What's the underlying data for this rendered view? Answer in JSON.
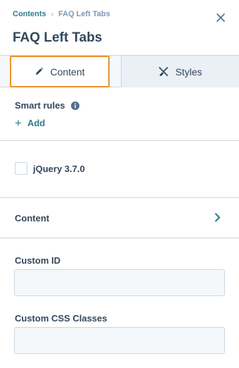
{
  "header": {
    "breadcrumb_root": "Contents",
    "breadcrumb_separator": "›",
    "breadcrumb_current": "FAQ Left Tabs",
    "title": "FAQ Left Tabs",
    "close_icon": "close-icon"
  },
  "tabs": [
    {
      "label": "Content",
      "icon": "pencil-icon",
      "selected": true
    },
    {
      "label": "Styles",
      "icon": "styles-icon",
      "selected": false
    }
  ],
  "smart_rules": {
    "label": "Smart rules",
    "info_icon": "info-icon",
    "add_label": "Add",
    "add_icon": "plus-icon"
  },
  "jquery": {
    "label": "jQuery 3.7.0",
    "checked": false
  },
  "content_section": {
    "label": "Content",
    "chevron_icon": "chevron-right-icon"
  },
  "fields": {
    "custom_id_label": "Custom ID",
    "custom_id_value": "",
    "custom_css_label": "Custom CSS Classes",
    "custom_css_value": ""
  },
  "colors": {
    "accent_teal": "#2d7e91",
    "selected_tab_border": "#f0912c",
    "text": "#33475b",
    "border": "#cbd6e2",
    "muted": "#7c98b6"
  }
}
